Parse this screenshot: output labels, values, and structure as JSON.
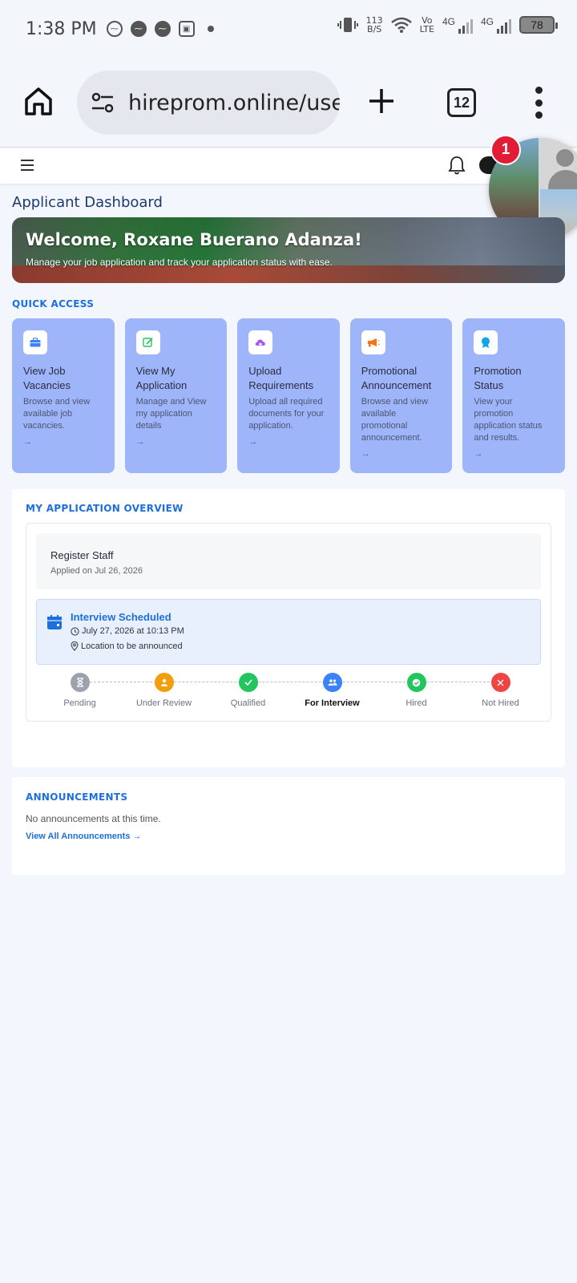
{
  "status_bar": {
    "time": "1:38 PM",
    "net_speed_value": "113",
    "net_speed_unit": "B/S",
    "volte_top": "Vo",
    "volte_bottom": "LTE",
    "network1": "4G",
    "network2": "4G",
    "battery": "78"
  },
  "browser": {
    "url": "hireprom.online/user",
    "tab_count": "12"
  },
  "chat_head": {
    "badge_count": "1"
  },
  "page": {
    "title": "Applicant Dashboard"
  },
  "banner": {
    "welcome": "Welcome, Roxane Buerano Adanza!",
    "subtitle": "Manage your job application and track your application status with ease."
  },
  "quick_access": {
    "label": "QUICK ACCESS",
    "cards": [
      {
        "title": "View Job Vacancies",
        "desc": "Browse and view available job vacancies.",
        "arrow": "→",
        "icon": "briefcase-icon",
        "color": "#3b82f6"
      },
      {
        "title": "View My Application",
        "desc": "Manage and View my application details",
        "arrow": "→",
        "icon": "edit-icon",
        "color": "#22c55e"
      },
      {
        "title": "Upload Requirements",
        "desc": "Upload all required documents for your application.",
        "arrow": "→",
        "icon": "cloud-upload-icon",
        "color": "#a855f7"
      },
      {
        "title": "Promotional Announcement",
        "desc": "Browse and view available promotional announcement.",
        "arrow": "→",
        "icon": "megaphone-icon",
        "color": "#f97316"
      },
      {
        "title": "Promotion Status",
        "desc": "View your promotion application status and results.",
        "arrow": "→",
        "icon": "award-icon",
        "color": "#0ea5e9"
      }
    ]
  },
  "overview": {
    "label": "MY APPLICATION OVERVIEW",
    "job_title": "Register Staff",
    "applied_on": "Applied on Jul 26, 2026",
    "interview": {
      "title": "Interview Scheduled",
      "when": "July 27, 2026 at 10:13 PM",
      "where": "Location to be announced"
    },
    "steps": [
      {
        "label": "Pending",
        "color": "#9ca3af",
        "icon": "hourglass-icon"
      },
      {
        "label": "Under Review",
        "color": "#f59e0b",
        "icon": "user-icon"
      },
      {
        "label": "Qualified",
        "color": "#22c55e",
        "icon": "check-icon"
      },
      {
        "label": "For Interview",
        "color": "#3b82f6",
        "icon": "users-icon"
      },
      {
        "label": "Hired",
        "color": "#22c55e",
        "icon": "check-circle-icon"
      },
      {
        "label": "Not Hired",
        "color": "#ef4444",
        "icon": "x-icon"
      }
    ],
    "active_step": "For Interview"
  },
  "announcements": {
    "label": "ANNOUNCEMENTS",
    "empty_text": "No announcements at this time.",
    "view_all": "View All Announcements →"
  }
}
